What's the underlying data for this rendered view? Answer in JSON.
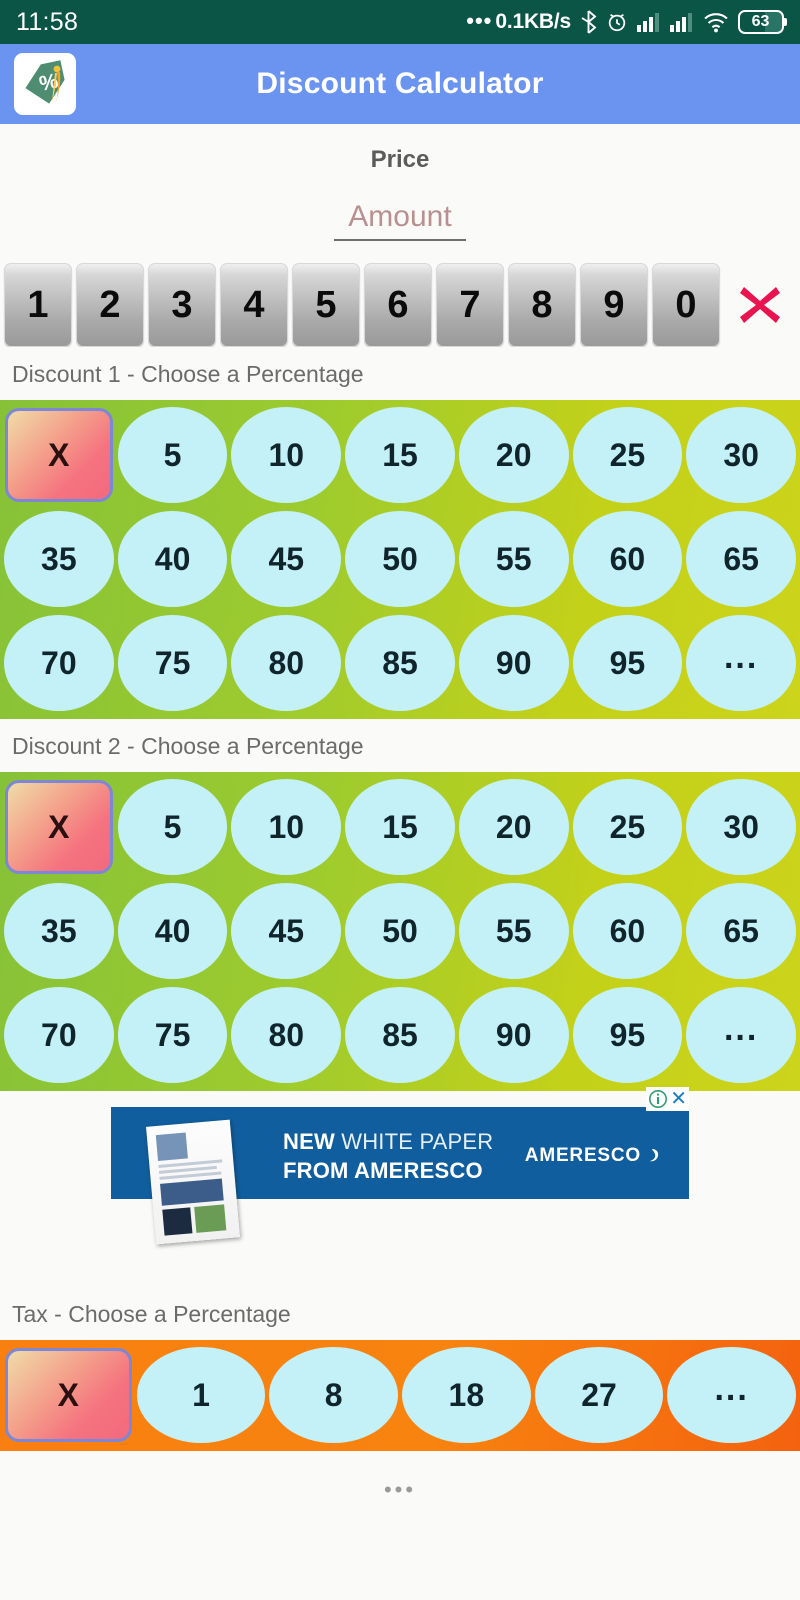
{
  "status_bar": {
    "clock": "11:58",
    "net_speed": "0.1KB/s",
    "leading_dots": "•••",
    "battery_level": "63",
    "icons": [
      "bluetooth-icon",
      "alarm-icon",
      "signal-icon",
      "signal-icon",
      "wifi-icon",
      "battery-icon"
    ],
    "background_color": "#0a5546"
  },
  "app_bar": {
    "title": "Discount Calculator",
    "icon_name": "app-logo-price-tag-percent",
    "background_color": "#6b94f0"
  },
  "price_section": {
    "label": "Price",
    "input_value": "",
    "input_placeholder": "Amount"
  },
  "keypad": {
    "keys": [
      "1",
      "2",
      "3",
      "4",
      "5",
      "6",
      "7",
      "8",
      "9",
      "0"
    ],
    "clear_icon": "red-x-clear-icon",
    "clear_color": "#e8134f"
  },
  "discount1": {
    "label": "Discount 1 - Choose a Percentage",
    "clear_label": "X",
    "options": [
      "5",
      "10",
      "15",
      "20",
      "25",
      "30",
      "35",
      "40",
      "45",
      "50",
      "55",
      "60",
      "65",
      "70",
      "75",
      "80",
      "85",
      "90",
      "95",
      "..."
    ],
    "background_color": "#9dcb2e",
    "button_color": "#c3f1f7"
  },
  "discount2": {
    "label": "Discount 2 - Choose a Percentage",
    "clear_label": "X",
    "options": [
      "5",
      "10",
      "15",
      "20",
      "25",
      "30",
      "35",
      "40",
      "45",
      "50",
      "55",
      "60",
      "65",
      "70",
      "75",
      "80",
      "85",
      "90",
      "95",
      "..."
    ],
    "background_color": "#9dcb2e",
    "button_color": "#c3f1f7"
  },
  "ad": {
    "headline_bold": "NEW",
    "headline_rest": " WHITE PAPER",
    "headline_line2": "FROM AMERESCO",
    "advertiser": "AMERESCO",
    "info_icon": "info-icon",
    "close_icon": "close-icon",
    "background_color": "#115e9e"
  },
  "tax": {
    "label": "Tax - Choose a Percentage",
    "clear_label": "X",
    "options": [
      "1",
      "8",
      "18",
      "27",
      "..."
    ],
    "background_color": "#f98010",
    "button_color": "#c3f1f7"
  },
  "footer": {
    "more_dots": "•••"
  }
}
